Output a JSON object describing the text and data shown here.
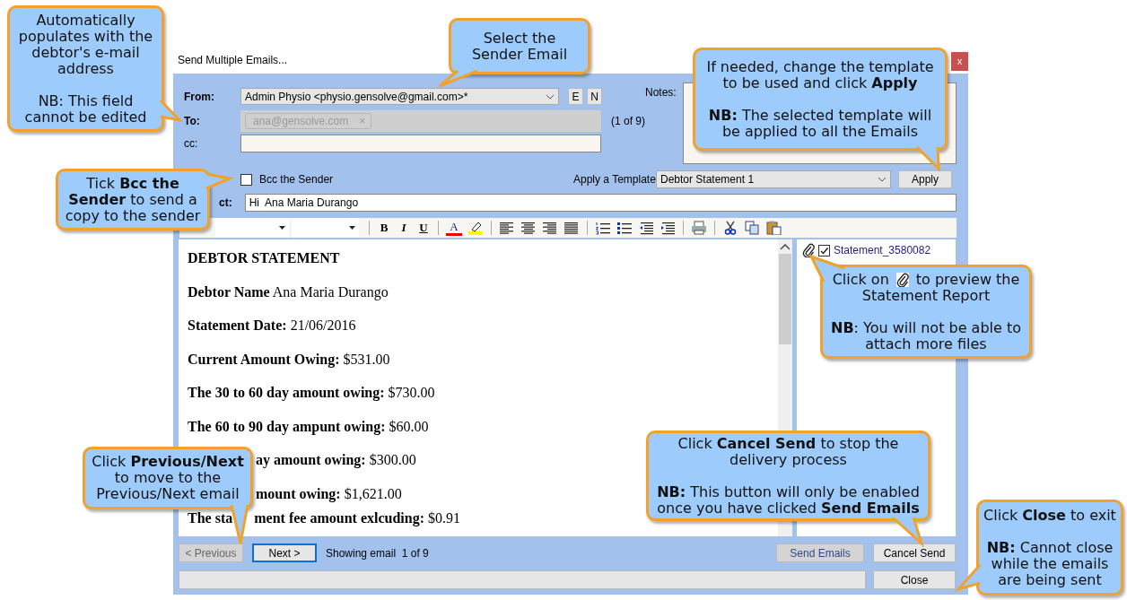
{
  "window": {
    "title": "Send Multiple Emails...",
    "close": "x"
  },
  "header": {
    "from_label": "From:",
    "from_value": "Admin Physio <physio.gensolve@gmail.com>*",
    "sender_buttons": [
      "E",
      "N"
    ],
    "to_label": "To:",
    "to_chips": [
      {
        "address": "ana@gensolve.com",
        "remove": "×"
      }
    ],
    "to_count": "(1 of 9)",
    "cc_label": "cc:",
    "notes_label": "Notes:",
    "bcc": {
      "label": "Bcc the Sender",
      "checked": false
    },
    "template_label": "Apply a Template",
    "template_value": "Debtor Statement 1",
    "apply_button": "Apply",
    "subject_label": "ct:",
    "subject_value": "Hi  Ana Maria Durango"
  },
  "toolbar": {
    "format_buttons": [
      "B",
      "I",
      "U"
    ],
    "font_color": "A"
  },
  "body": {
    "title": "DEBTOR STATEMENT",
    "lines": [
      {
        "kind": "line",
        "text": "**Debtor Name** Ana Maria Durango"
      },
      {
        "kind": "line",
        "text": "**Statement Date:** 21/06/2016"
      },
      {
        "kind": "line",
        "text": "**Current Amount Owing:** $531.00"
      },
      {
        "kind": "line",
        "text": "**The 30 to 60 day amount owing:** $730.00"
      },
      {
        "kind": "line",
        "text": "**The 60 to 90 day ampunt owing:** $60.00"
      },
      {
        "kind": "covered",
        "text": "**ay amount owing:** $300.00"
      },
      {
        "kind": "covered",
        "text": "**mount owing:** $1,621.00"
      },
      {
        "kind": "split",
        "text": "**The sta**",
        "rest": "**ment fee amount exlcuding:** $0.91"
      }
    ]
  },
  "attachments": [
    {
      "name": "Statement_3580082",
      "checked": true
    }
  ],
  "footer": {
    "previous": {
      "label": "< Previous",
      "disabled": true
    },
    "next": {
      "label": "Next >",
      "disabled": false,
      "focused": true
    },
    "showing": "Showing email  1 of 9",
    "send": {
      "label": "Send Emails",
      "disabled": true
    },
    "cancel": {
      "label": "Cancel Send",
      "disabled": false
    },
    "close": {
      "label": "Close",
      "disabled": false
    }
  },
  "callouts": [
    {
      "paragraphs": [
        {
          "kind": "text",
          "text": "Automatically populates with the debtor's e-mail address"
        },
        {
          "kind": "text",
          "text": "NB: This field cannot be edited"
        }
      ]
    },
    {
      "paragraphs": [
        {
          "kind": "text",
          "text": "Select the Sender Email"
        }
      ]
    },
    {
      "paragraphs": [
        {
          "kind": "text",
          "text": "If needed, change the template to be used and click **Apply**"
        },
        {
          "kind": "text",
          "text": "**NB:** The selected template will be applied to all the Emails"
        }
      ]
    },
    {
      "paragraphs": [
        {
          "kind": "text",
          "text": "Tick **Bcc the Sender** to send a copy to the sender"
        }
      ]
    },
    {
      "paragraphs": [
        {
          "kind": "icon_text",
          "before": "Click on",
          "after": "to preview the",
          "rest": "Statement Report"
        },
        {
          "kind": "text",
          "text": "**NB**: You will not be able to attach more files"
        }
      ]
    },
    {
      "paragraphs": [
        {
          "kind": "text",
          "text": "Click **Previous/Next** to move to the Previous/Next email"
        }
      ]
    },
    {
      "paragraphs": [
        {
          "kind": "text",
          "text": "Click **Cancel Send** to stop the delivery process"
        },
        {
          "kind": "text",
          "text": "**NB:** This button will only be enabled once you have clicked **Send Emails**"
        }
      ]
    },
    {
      "paragraphs": [
        {
          "kind": "text",
          "text": "Click **Close** to exit"
        },
        {
          "kind": "text",
          "text": "**NB:** Cannot close while the emails are being sent"
        }
      ]
    }
  ]
}
